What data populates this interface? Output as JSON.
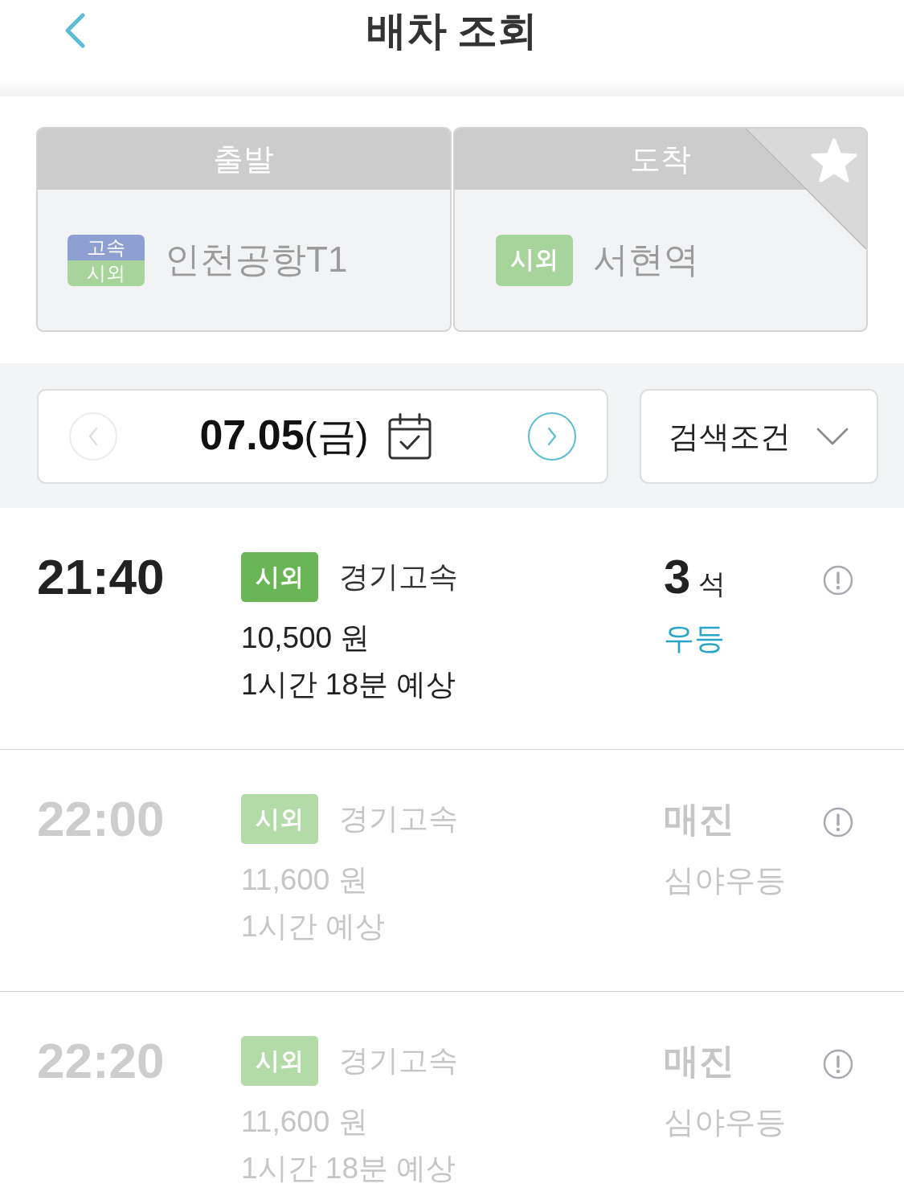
{
  "header": {
    "title": "배차 조회"
  },
  "route": {
    "departure": {
      "label": "출발",
      "tags": [
        {
          "text": "고속",
          "color": "#8e9fd2"
        },
        {
          "text": "시외",
          "color": "#a6d49b"
        }
      ],
      "station": "인천공항T1"
    },
    "arrival": {
      "label": "도착",
      "tags": [
        {
          "text": "시외",
          "color": "#a6d49b"
        }
      ],
      "station": "서현역"
    }
  },
  "date_bar": {
    "prev": {
      "disabled": true
    },
    "date": "**07.05**(금)",
    "next": {
      "disabled": false
    },
    "filter": "검색조건"
  },
  "schedules": [
    {
      "time": "21:40",
      "tag": "시외",
      "company": "경기고속",
      "price": "10,500 원",
      "duration": "1시간 18분 예상",
      "sold_out": false,
      "seats": "3",
      "seat_unit": "석",
      "grade": "우등"
    },
    {
      "time": "22:00",
      "tag": "시외",
      "company": "경기고속",
      "price": "11,600 원",
      "duration": "1시간 예상",
      "sold_out": true,
      "status": "매진",
      "grade": "심야우등"
    },
    {
      "time": "22:20",
      "tag": "시외",
      "company": "경기고속",
      "price": "11,600 원",
      "duration": "1시간 18분 예상",
      "sold_out": true,
      "status": "매진",
      "grade": "심야우등"
    }
  ]
}
